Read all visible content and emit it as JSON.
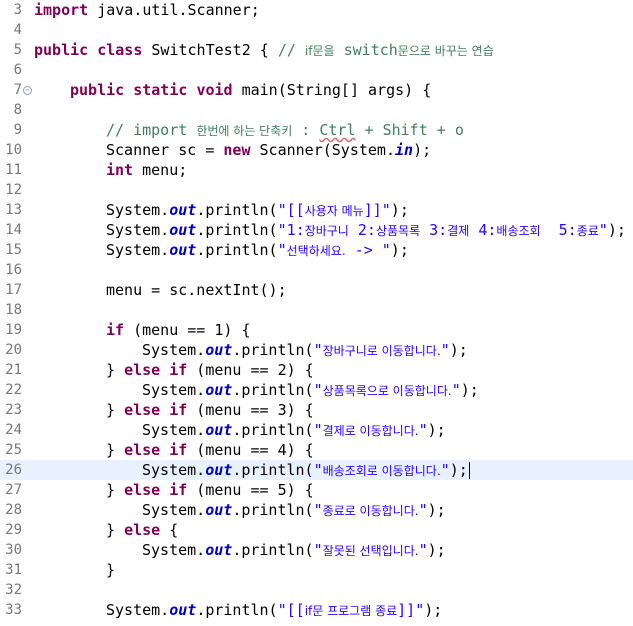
{
  "editor": {
    "current_line": "26",
    "lines": [
      {
        "num": "3",
        "indent": 0,
        "tokens": [
          {
            "t": "import",
            "c": "kw"
          },
          {
            "t": " java.util.Scanner;",
            "c": ""
          }
        ]
      },
      {
        "num": "4",
        "indent": 0,
        "tokens": []
      },
      {
        "num": "5",
        "indent": 0,
        "tokens": [
          {
            "t": "public",
            "c": "kw"
          },
          {
            "t": " ",
            "c": ""
          },
          {
            "t": "class",
            "c": "kw"
          },
          {
            "t": " SwitchTest2 { ",
            "c": ""
          },
          {
            "t": "// ",
            "c": "cmt"
          },
          {
            "t": "if문을",
            "c": "cmt ko"
          },
          {
            "t": " switch",
            "c": "cmt"
          },
          {
            "t": "문으로 바꾸는 연습",
            "c": "cmt ko"
          }
        ]
      },
      {
        "num": "6",
        "indent": 0,
        "tokens": []
      },
      {
        "num": "7",
        "indent": 1,
        "fold": "⊖",
        "tokens": [
          {
            "t": "public",
            "c": "kw"
          },
          {
            "t": " ",
            "c": ""
          },
          {
            "t": "static",
            "c": "kw"
          },
          {
            "t": " ",
            "c": ""
          },
          {
            "t": "void",
            "c": "kw"
          },
          {
            "t": " main(String[] args) {",
            "c": ""
          }
        ]
      },
      {
        "num": "8",
        "indent": 0,
        "tokens": []
      },
      {
        "num": "9",
        "indent": 2,
        "tokens": [
          {
            "t": "// import ",
            "c": "cmt"
          },
          {
            "t": "한번에 하는 단축키",
            "c": "cmt ko"
          },
          {
            "t": " : ",
            "c": "cmt"
          },
          {
            "t": "Ctrl",
            "c": "cmt squig"
          },
          {
            "t": " + Shift + o",
            "c": "cmt"
          }
        ]
      },
      {
        "num": "10",
        "indent": 2,
        "tokens": [
          {
            "t": "Scanner sc = ",
            "c": ""
          },
          {
            "t": "new",
            "c": "kw"
          },
          {
            "t": " Scanner(System.",
            "c": ""
          },
          {
            "t": "in",
            "c": "fld"
          },
          {
            "t": ");",
            "c": ""
          }
        ]
      },
      {
        "num": "11",
        "indent": 2,
        "tokens": [
          {
            "t": "int",
            "c": "kw"
          },
          {
            "t": " menu;",
            "c": ""
          }
        ]
      },
      {
        "num": "12",
        "indent": 0,
        "tokens": []
      },
      {
        "num": "13",
        "indent": 2,
        "tokens": [
          {
            "t": "System.",
            "c": ""
          },
          {
            "t": "out",
            "c": "fld"
          },
          {
            "t": ".println(",
            "c": ""
          },
          {
            "t": "\"[[",
            "c": "str"
          },
          {
            "t": "사용자 메뉴",
            "c": "str ko"
          },
          {
            "t": "]]\"",
            "c": "str"
          },
          {
            "t": ");",
            "c": ""
          }
        ]
      },
      {
        "num": "14",
        "indent": 2,
        "tokens": [
          {
            "t": "System.",
            "c": ""
          },
          {
            "t": "out",
            "c": "fld"
          },
          {
            "t": ".println(",
            "c": ""
          },
          {
            "t": "\"1:",
            "c": "str"
          },
          {
            "t": "장바구니",
            "c": "str ko"
          },
          {
            "t": " 2:",
            "c": "str"
          },
          {
            "t": "상품목록",
            "c": "str ko"
          },
          {
            "t": " 3:",
            "c": "str"
          },
          {
            "t": "결제",
            "c": "str ko"
          },
          {
            "t": " 4:",
            "c": "str"
          },
          {
            "t": "배송조회",
            "c": "str ko"
          },
          {
            "t": "  5:",
            "c": "str"
          },
          {
            "t": "종료",
            "c": "str ko"
          },
          {
            "t": "\"",
            "c": "str"
          },
          {
            "t": ");",
            "c": ""
          }
        ]
      },
      {
        "num": "15",
        "indent": 2,
        "tokens": [
          {
            "t": "System.",
            "c": ""
          },
          {
            "t": "out",
            "c": "fld"
          },
          {
            "t": ".println(",
            "c": ""
          },
          {
            "t": "\"",
            "c": "str"
          },
          {
            "t": "선택하세요.",
            "c": "str ko"
          },
          {
            "t": " -> \"",
            "c": "str"
          },
          {
            "t": ");",
            "c": ""
          }
        ]
      },
      {
        "num": "16",
        "indent": 0,
        "tokens": []
      },
      {
        "num": "17",
        "indent": 2,
        "tokens": [
          {
            "t": "menu = sc.nextInt();",
            "c": ""
          }
        ]
      },
      {
        "num": "18",
        "indent": 0,
        "tokens": []
      },
      {
        "num": "19",
        "indent": 2,
        "tokens": [
          {
            "t": "if",
            "c": "kw"
          },
          {
            "t": " (menu == 1) {",
            "c": ""
          }
        ]
      },
      {
        "num": "20",
        "indent": 3,
        "tokens": [
          {
            "t": "System.",
            "c": ""
          },
          {
            "t": "out",
            "c": "fld"
          },
          {
            "t": ".println(",
            "c": ""
          },
          {
            "t": "\"",
            "c": "str"
          },
          {
            "t": "장바구니로 이동합니다.",
            "c": "str ko"
          },
          {
            "t": "\"",
            "c": "str"
          },
          {
            "t": ");",
            "c": ""
          }
        ]
      },
      {
        "num": "21",
        "indent": 2,
        "tokens": [
          {
            "t": "} ",
            "c": ""
          },
          {
            "t": "else",
            "c": "kw"
          },
          {
            "t": " ",
            "c": ""
          },
          {
            "t": "if",
            "c": "kw"
          },
          {
            "t": " (menu == 2) {",
            "c": ""
          }
        ]
      },
      {
        "num": "22",
        "indent": 3,
        "tokens": [
          {
            "t": "System.",
            "c": ""
          },
          {
            "t": "out",
            "c": "fld"
          },
          {
            "t": ".println(",
            "c": ""
          },
          {
            "t": "\"",
            "c": "str"
          },
          {
            "t": "상품목록으로 이동합니다.",
            "c": "str ko"
          },
          {
            "t": "\"",
            "c": "str"
          },
          {
            "t": ");",
            "c": ""
          }
        ]
      },
      {
        "num": "23",
        "indent": 2,
        "tokens": [
          {
            "t": "} ",
            "c": ""
          },
          {
            "t": "else",
            "c": "kw"
          },
          {
            "t": " ",
            "c": ""
          },
          {
            "t": "if",
            "c": "kw"
          },
          {
            "t": " (menu == 3) {",
            "c": ""
          }
        ]
      },
      {
        "num": "24",
        "indent": 3,
        "tokens": [
          {
            "t": "System.",
            "c": ""
          },
          {
            "t": "out",
            "c": "fld"
          },
          {
            "t": ".println(",
            "c": ""
          },
          {
            "t": "\"",
            "c": "str"
          },
          {
            "t": "결제로 이동합니다.",
            "c": "str ko"
          },
          {
            "t": "\"",
            "c": "str"
          },
          {
            "t": ");",
            "c": ""
          }
        ]
      },
      {
        "num": "25",
        "indent": 2,
        "tokens": [
          {
            "t": "} ",
            "c": ""
          },
          {
            "t": "else",
            "c": "kw"
          },
          {
            "t": " ",
            "c": ""
          },
          {
            "t": "if",
            "c": "kw"
          },
          {
            "t": " (menu == 4) {",
            "c": ""
          }
        ]
      },
      {
        "num": "26",
        "indent": 3,
        "caret": true,
        "tokens": [
          {
            "t": "System.",
            "c": ""
          },
          {
            "t": "out",
            "c": "fld"
          },
          {
            "t": ".println(",
            "c": ""
          },
          {
            "t": "\"",
            "c": "str"
          },
          {
            "t": "배송조회로 이동합니다.",
            "c": "str ko"
          },
          {
            "t": "\"",
            "c": "str"
          },
          {
            "t": ");",
            "c": ""
          }
        ]
      },
      {
        "num": "27",
        "indent": 2,
        "tokens": [
          {
            "t": "} ",
            "c": ""
          },
          {
            "t": "else",
            "c": "kw"
          },
          {
            "t": " ",
            "c": ""
          },
          {
            "t": "if",
            "c": "kw"
          },
          {
            "t": " (menu == 5) {",
            "c": ""
          }
        ]
      },
      {
        "num": "28",
        "indent": 3,
        "tokens": [
          {
            "t": "System.",
            "c": ""
          },
          {
            "t": "out",
            "c": "fld"
          },
          {
            "t": ".println(",
            "c": ""
          },
          {
            "t": "\"",
            "c": "str"
          },
          {
            "t": "종료로 이동합니다.",
            "c": "str ko"
          },
          {
            "t": "\"",
            "c": "str"
          },
          {
            "t": ");",
            "c": ""
          }
        ]
      },
      {
        "num": "29",
        "indent": 2,
        "tokens": [
          {
            "t": "} ",
            "c": ""
          },
          {
            "t": "else",
            "c": "kw"
          },
          {
            "t": " {",
            "c": ""
          }
        ]
      },
      {
        "num": "30",
        "indent": 3,
        "tokens": [
          {
            "t": "System.",
            "c": ""
          },
          {
            "t": "out",
            "c": "fld"
          },
          {
            "t": ".println(",
            "c": ""
          },
          {
            "t": "\"",
            "c": "str"
          },
          {
            "t": "잘못된 선택입니다.",
            "c": "str ko"
          },
          {
            "t": "\"",
            "c": "str"
          },
          {
            "t": ");",
            "c": ""
          }
        ]
      },
      {
        "num": "31",
        "indent": 2,
        "tokens": [
          {
            "t": "}",
            "c": ""
          }
        ]
      },
      {
        "num": "32",
        "indent": 0,
        "tokens": []
      },
      {
        "num": "33",
        "indent": 2,
        "tokens": [
          {
            "t": "System.",
            "c": ""
          },
          {
            "t": "out",
            "c": "fld"
          },
          {
            "t": ".println(",
            "c": ""
          },
          {
            "t": "\"[[",
            "c": "str"
          },
          {
            "t": "if문 프로그램 종료",
            "c": "str ko"
          },
          {
            "t": "]]\"",
            "c": "str"
          },
          {
            "t": ");",
            "c": ""
          }
        ]
      }
    ]
  },
  "colors": {
    "keyword": "#7f0055",
    "string": "#2a00ff",
    "comment": "#3f7f5f",
    "static_field": "#0000c0",
    "line_number": "#787878",
    "current_line_bg": "#e8f2fe"
  }
}
